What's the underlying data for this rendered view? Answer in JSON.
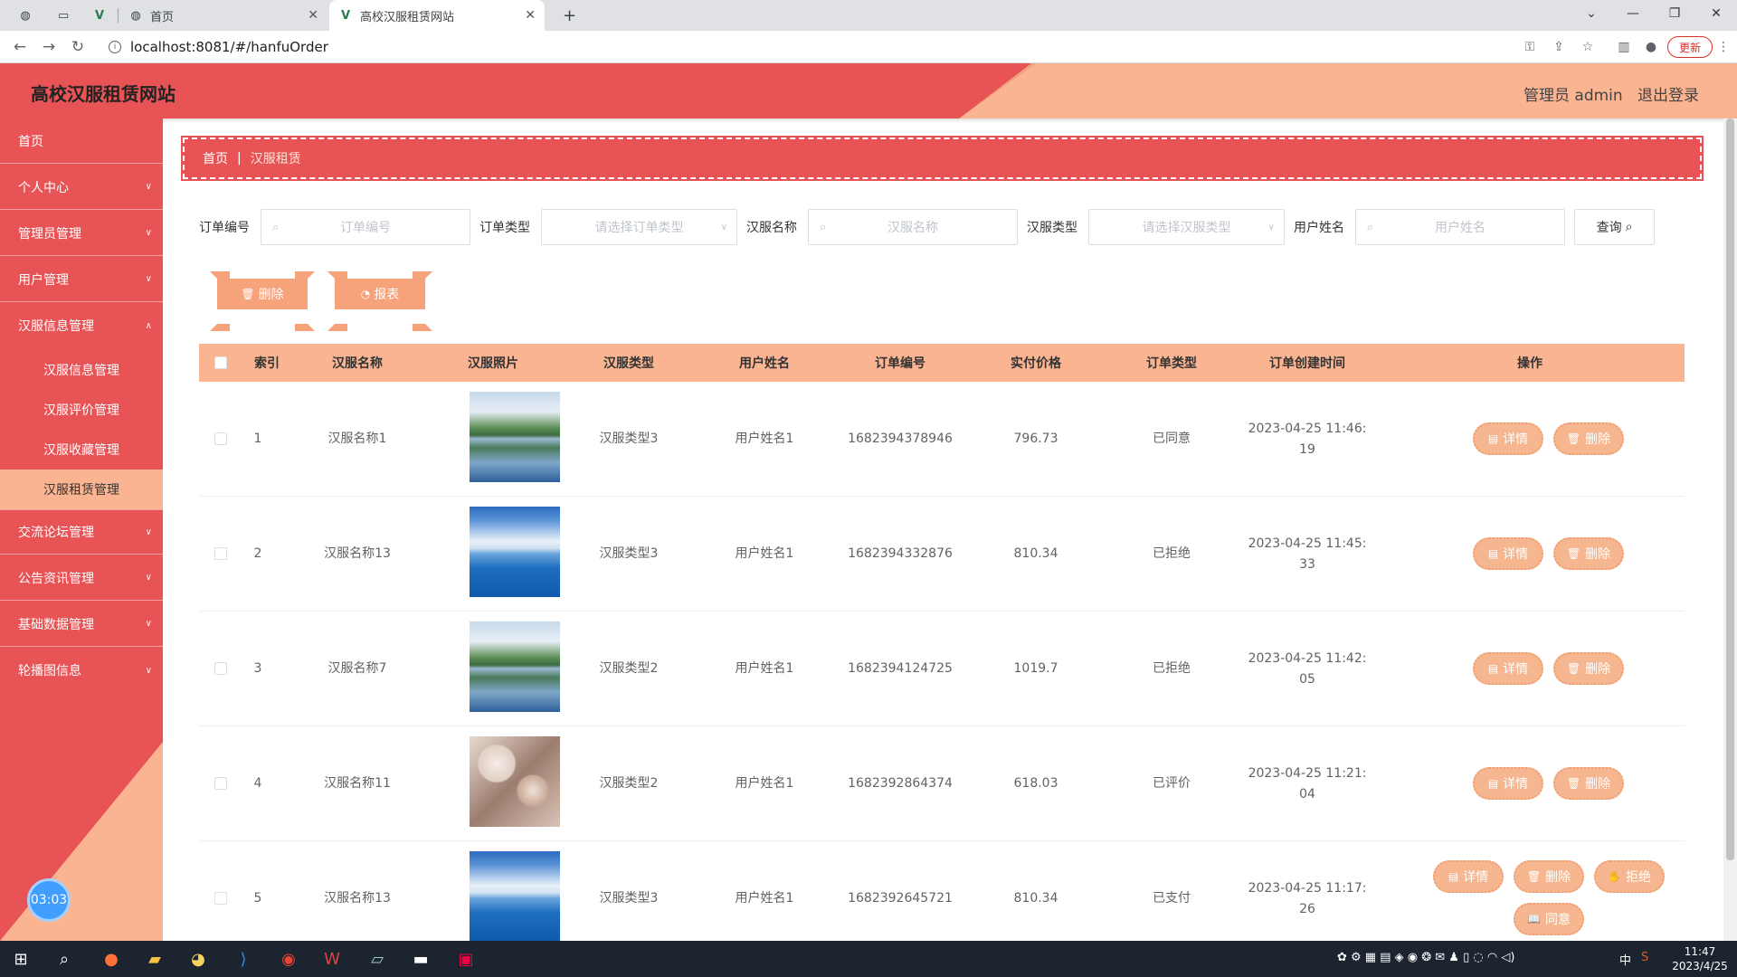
{
  "browser": {
    "tabs": [
      {
        "title": "首页"
      },
      {
        "title": "高校汉服租赁网站"
      }
    ],
    "url": "localhost:8081/#/hanfuOrder",
    "update_label": "更新"
  },
  "header": {
    "title": "高校汉服租赁网站",
    "user_label": "管理员 admin",
    "logout_label": "退出登录"
  },
  "sidebar": {
    "items": [
      {
        "label": "首页"
      },
      {
        "label": "个人中心"
      },
      {
        "label": "管理员管理"
      },
      {
        "label": "用户管理"
      },
      {
        "label": "汉服信息管理"
      },
      {
        "label": "交流论坛管理"
      },
      {
        "label": "公告资讯管理"
      },
      {
        "label": "基础数据管理"
      },
      {
        "label": "轮播图信息"
      }
    ],
    "sub_items": [
      {
        "label": "汉服信息管理"
      },
      {
        "label": "汉服评价管理"
      },
      {
        "label": "汉服收藏管理"
      },
      {
        "label": "汉服租赁管理"
      }
    ],
    "timer": "03:03"
  },
  "breadcrumb": {
    "home": "首页",
    "sep": "|",
    "current": "汉服租赁"
  },
  "filters": {
    "order_no": {
      "label": "订单编号",
      "placeholder": "订单编号"
    },
    "order_type": {
      "label": "订单类型",
      "placeholder": "请选择订单类型"
    },
    "hanfu_name": {
      "label": "汉服名称",
      "placeholder": "汉服名称"
    },
    "hanfu_type": {
      "label": "汉服类型",
      "placeholder": "请选择汉服类型"
    },
    "user_name": {
      "label": "用户姓名",
      "placeholder": "用户姓名"
    },
    "query_label": "查询"
  },
  "actions": {
    "delete_label": "删除",
    "report_label": "报表"
  },
  "table": {
    "headers": [
      "索引",
      "汉服名称",
      "汉服照片",
      "汉服类型",
      "用户姓名",
      "订单编号",
      "实付价格",
      "订单类型",
      "订单创建时间",
      "操作"
    ],
    "rows": [
      {
        "index": "1",
        "name": "汉服名称1",
        "image": "mountain-lake",
        "type": "汉服类型3",
        "user": "用户姓名1",
        "order_no": "1682394378946",
        "price": "796.73",
        "status": "已同意",
        "time_line1": "2023-04-25 11:46:",
        "time_line2": "19"
      },
      {
        "index": "2",
        "name": "汉服名称13",
        "image": "sea-sky",
        "type": "汉服类型3",
        "user": "用户姓名1",
        "order_no": "1682394332876",
        "price": "810.34",
        "status": "已拒绝",
        "time_line1": "2023-04-25 11:45:",
        "time_line2": "33"
      },
      {
        "index": "3",
        "name": "汉服名称7",
        "image": "mountain-lake",
        "type": "汉服类型2",
        "user": "用户姓名1",
        "order_no": "1682394124725",
        "price": "1019.7",
        "status": "已拒绝",
        "time_line1": "2023-04-25 11:42:",
        "time_line2": "05"
      },
      {
        "index": "4",
        "name": "汉服名称11",
        "image": "blossom",
        "type": "汉服类型2",
        "user": "用户姓名1",
        "order_no": "1682392864374",
        "price": "618.03",
        "status": "已评价",
        "time_line1": "2023-04-25 11:21:",
        "time_line2": "04"
      },
      {
        "index": "5",
        "name": "汉服名称13",
        "image": "sea-sky",
        "type": "汉服类型3",
        "user": "用户姓名1",
        "order_no": "1682392645721",
        "price": "810.34",
        "status": "已支付",
        "time_line1": "2023-04-25 11:17:",
        "time_line2": "26"
      }
    ],
    "op_labels": {
      "detail": "详情",
      "delete": "删除",
      "reject": "拒绝",
      "agree": "同意"
    }
  },
  "taskbar": {
    "time": "11:47",
    "date": "2023/4/25",
    "ime": "中"
  }
}
